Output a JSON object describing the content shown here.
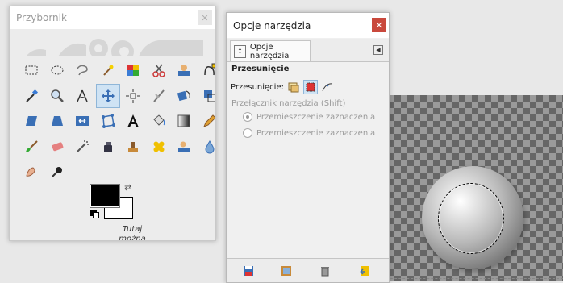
{
  "toolbox": {
    "title": "Przybornik",
    "close_label": "✕",
    "hint_text": "Tutaj można",
    "colors": {
      "foreground": "#000000",
      "background": "#ffffff"
    }
  },
  "tool_options": {
    "title": "Opcje narzędzia",
    "close_label": "✕",
    "tab_label": "Opcje narzędzia",
    "tab_menu_label": "◀",
    "section_title": "Przesunięcie",
    "move_label": "Przesunięcie:",
    "switch_label": "Przełącznik narzędzia  (Shift)",
    "radio_options": [
      {
        "label": "Przemieszczenie zaznaczenia",
        "selected": true
      },
      {
        "label": "Przemieszczenie zaznaczenia",
        "selected": false
      }
    ]
  },
  "tools": [
    "rect-select-icon",
    "ellipse-select-icon",
    "free-select-icon",
    "fuzzy-select-icon",
    "select-by-color-icon",
    "scissors-select-icon",
    "foreground-select-icon",
    "paths-icon",
    "color-picker-icon",
    "zoom-icon",
    "measure-icon",
    "move-icon",
    "align-icon",
    "crop-icon",
    "rotate-icon",
    "scale-icon",
    "shear-icon",
    "perspective-icon",
    "flip-icon",
    "cage-transform-icon",
    "text-icon",
    "bucket-fill-icon",
    "blend-icon",
    "pencil-icon",
    "paintbrush-icon",
    "eraser-icon",
    "airbrush-icon",
    "ink-icon",
    "clone-icon",
    "heal-icon",
    "perspective-clone-icon",
    "blur-sharpen-icon",
    "smudge-icon",
    "dodge-burn-icon"
  ],
  "accent_color": "#cfe3f4"
}
